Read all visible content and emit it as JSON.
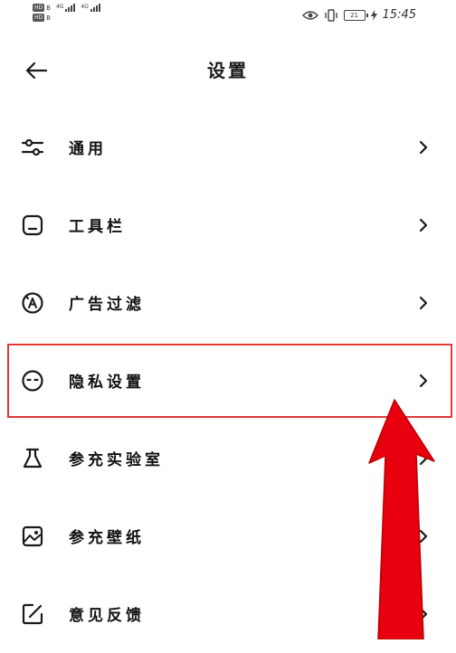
{
  "status_bar": {
    "sim1_badge": "HD",
    "sim1_num": "B",
    "sim2_badge": "HD",
    "sim2_num": "B",
    "net1": "4G",
    "net2": "4G",
    "battery": "21",
    "time": "15:45"
  },
  "header": {
    "title": "设置"
  },
  "menu": {
    "items": [
      {
        "label": "通用",
        "icon": "sliders-icon"
      },
      {
        "label": "工具栏",
        "icon": "toolbar-icon"
      },
      {
        "label": "广告过滤",
        "icon": "ad-block-icon"
      },
      {
        "label": "隐私设置",
        "icon": "privacy-icon"
      },
      {
        "label": "参充实验室",
        "icon": "flask-icon"
      },
      {
        "label": "参充壁纸",
        "icon": "wallpaper-icon"
      },
      {
        "label": "意见反馈",
        "icon": "feedback-icon"
      }
    ]
  },
  "annotation": {
    "highlight_color": "#e03a3a",
    "arrow_color": "#e8000f"
  }
}
